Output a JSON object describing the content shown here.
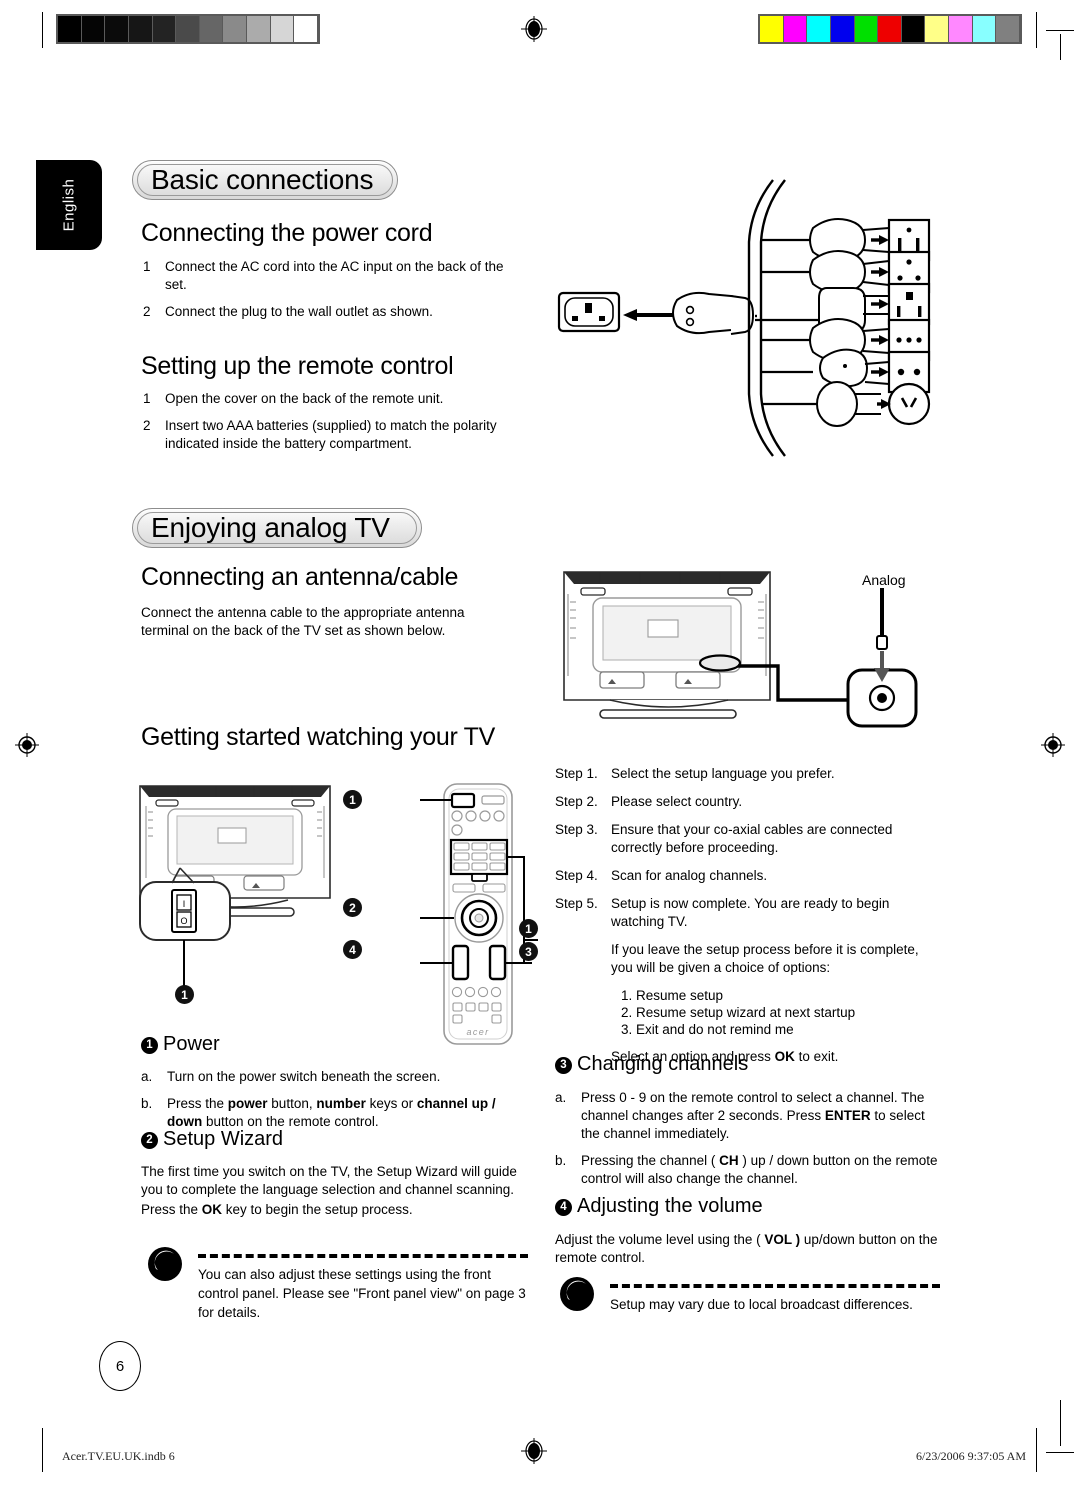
{
  "calibration": {
    "grayscale_swatches": [
      "#000000",
      "#050505",
      "#0b0b0b",
      "#161616",
      "#232323",
      "#4a4a4a",
      "#666666",
      "#8a8a8a",
      "#ababab",
      "#d6d6d6",
      "#ffffff"
    ],
    "color_swatches": [
      "#ffff00",
      "#ff00ff",
      "#00ffff",
      "#0000ee",
      "#00e000",
      "#ee0000",
      "#000000",
      "#ffff88",
      "#ff88ff",
      "#88ffff",
      "#808080"
    ]
  },
  "side_tab": {
    "language": "English"
  },
  "sections": {
    "basic_connections": {
      "banner": "Basic connections",
      "power_cord": {
        "heading": "Connecting the power cord",
        "steps": [
          {
            "n": "1",
            "text": "Connect the AC cord into the AC input on the back of the set."
          },
          {
            "n": "2",
            "text": "Connect the plug to the wall outlet as shown."
          }
        ]
      },
      "remote_setup": {
        "heading": "Setting up the remote control",
        "steps": [
          {
            "n": "1",
            "text": "Open the cover on the back of the remote unit."
          },
          {
            "n": "2",
            "text": "Insert two AAA batteries (supplied) to match the polarity indicated inside the battery compartment."
          }
        ]
      }
    },
    "enjoying_analog_tv": {
      "banner": "Enjoying analog TV",
      "antenna": {
        "heading": "Connecting an antenna/cable",
        "text": "Connect the antenna cable to the appropriate antenna terminal on the back of the TV set as shown below.",
        "diagram_label": "Analog"
      },
      "getting_started": {
        "heading": "Getting started watching your TV",
        "remote_callouts": [
          "1",
          "2",
          "3",
          "4"
        ],
        "tv_callout": "1",
        "remote_brand": "acer",
        "power_switch_marks": [
          "I",
          "O"
        ]
      }
    }
  },
  "left_column": {
    "power": {
      "num": "1",
      "title": "Power",
      "items": [
        {
          "k": "a.",
          "text": "Turn on the power switch beneath the screen."
        },
        {
          "k": "b.",
          "pre": "Press the ",
          "b1": "power",
          "mid1": " button, ",
          "b2": "number",
          "mid2": " keys or ",
          "b3": "channel up / down",
          "post": " button on the remote control."
        }
      ]
    },
    "setup_wizard": {
      "num": "2",
      "title": "Setup Wizard",
      "para1": "The first time you switch on the TV, the Setup Wizard will guide you to complete the language selection and channel scanning.",
      "para2_pre": "Press the ",
      "para2_b": "OK",
      "para2_post": " key to begin the setup process."
    },
    "note": {
      "icon": "acer-note-icon",
      "text": "You can also adjust these settings using the front control panel. Please see \"Front panel view\" on page 3 for details."
    }
  },
  "right_column": {
    "steps": [
      {
        "k": "Step 1.",
        "v": "Select the setup language you prefer."
      },
      {
        "k": "Step 2.",
        "v": "Please select country."
      },
      {
        "k": "Step 3.",
        "v": "Ensure that your co-axial cables are connected correctly before proceeding."
      },
      {
        "k": "Step 4.",
        "v": "Scan for analog channels."
      },
      {
        "k": "Step 5.",
        "v": "Setup is now complete. You are ready to begin watching TV."
      }
    ],
    "step5_note": "If you leave the setup process before it is complete, you will be given a choice of options:",
    "options": [
      "1. Resume setup",
      "2. Resume setup wizard at next startup",
      "3. Exit and do not remind me"
    ],
    "select_pre": "Select an option and press ",
    "select_b": "OK",
    "select_post": " to exit.",
    "changing_channels": {
      "num": "3",
      "title": "Changing channels",
      "items": [
        {
          "k": "a.",
          "pre": "Press 0 - 9 on the remote control to select a channel. The channel changes after 2 seconds. Press ",
          "b": "ENTER",
          "post": " to select the channel immediately."
        },
        {
          "k": "b.",
          "pre": "Pressing the channel ( ",
          "b": "CH",
          "post": " ) up / down button on the remote control will also change the channel."
        }
      ]
    },
    "adjusting_volume": {
      "num": "4",
      "title": "Adjusting the volume",
      "pre": "Adjust the volume level using the ( ",
      "b": "VOL )",
      "post": " up/down button on the remote control."
    },
    "note": {
      "icon": "acer-note-icon",
      "text": "Setup may vary due to local broadcast differences."
    }
  },
  "footer": {
    "page_number": "6",
    "file_name": "Acer.TV.EU.UK.indb   6",
    "timestamp": "6/23/2006   9:37:05 AM"
  }
}
